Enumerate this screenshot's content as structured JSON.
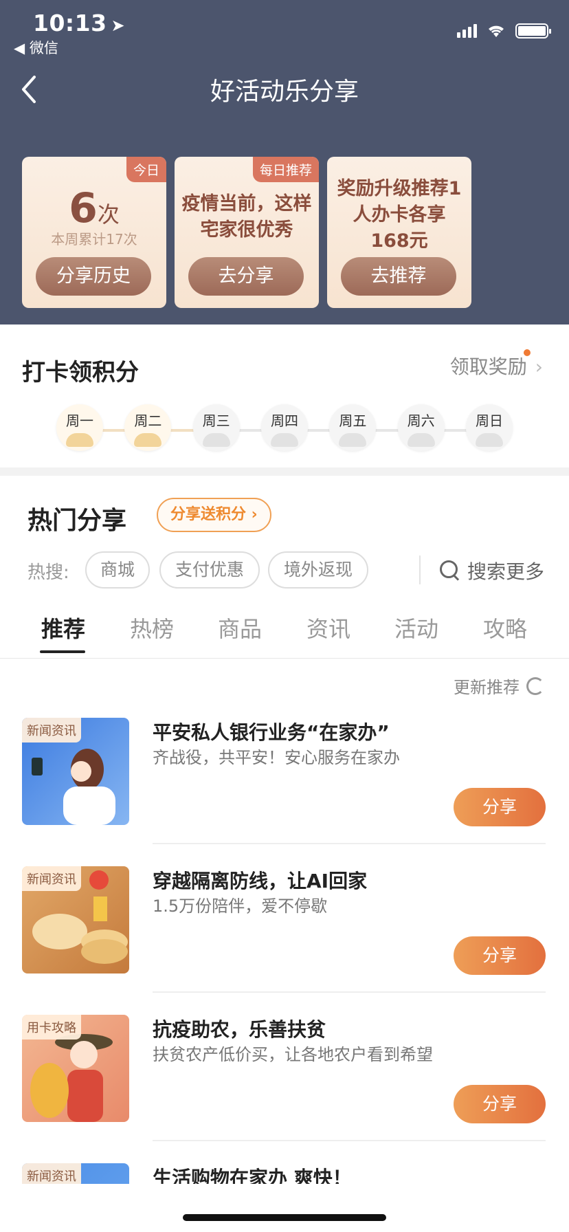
{
  "status": {
    "time": "10:13",
    "back_app": "◀ 微信"
  },
  "nav": {
    "title": "好活动乐分享"
  },
  "cards": {
    "today": {
      "tag": "今日",
      "count": "6",
      "unit": "次",
      "weekly": "本周累计17次",
      "button": "分享历史"
    },
    "daily": {
      "tag": "每日推荐",
      "text": "疫情当前，这样宅家很优秀",
      "button": "去分享"
    },
    "reward": {
      "text": "奖励升级推荐1人办卡各享168元",
      "button": "去推荐"
    }
  },
  "checkin": {
    "title": "打卡领积分",
    "reward_link": "领取奖励",
    "days": [
      "周一",
      "周二",
      "周三",
      "周四",
      "周五",
      "周六",
      "周日"
    ],
    "completed_days": 2
  },
  "hot": {
    "title": "热门分享",
    "points_button": "分享送积分 ›",
    "search_label": "热搜:",
    "chips": [
      "商城",
      "支付优惠",
      "境外返现"
    ],
    "search_more": "搜索更多"
  },
  "tabs": [
    "推荐",
    "热榜",
    "商品",
    "资讯",
    "活动",
    "攻略"
  ],
  "active_tab": "推荐",
  "refresh": "更新推荐",
  "items": [
    {
      "badge": "新闻资讯",
      "title": "平安私人银行业务“在家办”",
      "desc": "齐战役，共平安！安心服务在家办",
      "share": "分享"
    },
    {
      "badge": "新闻资讯",
      "title": "穿越隔离防线，让AI回家",
      "desc": "1.5万份陪伴，爱不停歇",
      "share": "分享"
    },
    {
      "badge": "用卡攻略",
      "title": "抗疫助农，乐善扶贫",
      "desc": "扶贫农产低价买，让各地农户看到希望",
      "share": "分享"
    },
    {
      "badge": "新闻资讯",
      "title": "生活购物在家办 爽快！",
      "desc": "",
      "share": ""
    }
  ]
}
